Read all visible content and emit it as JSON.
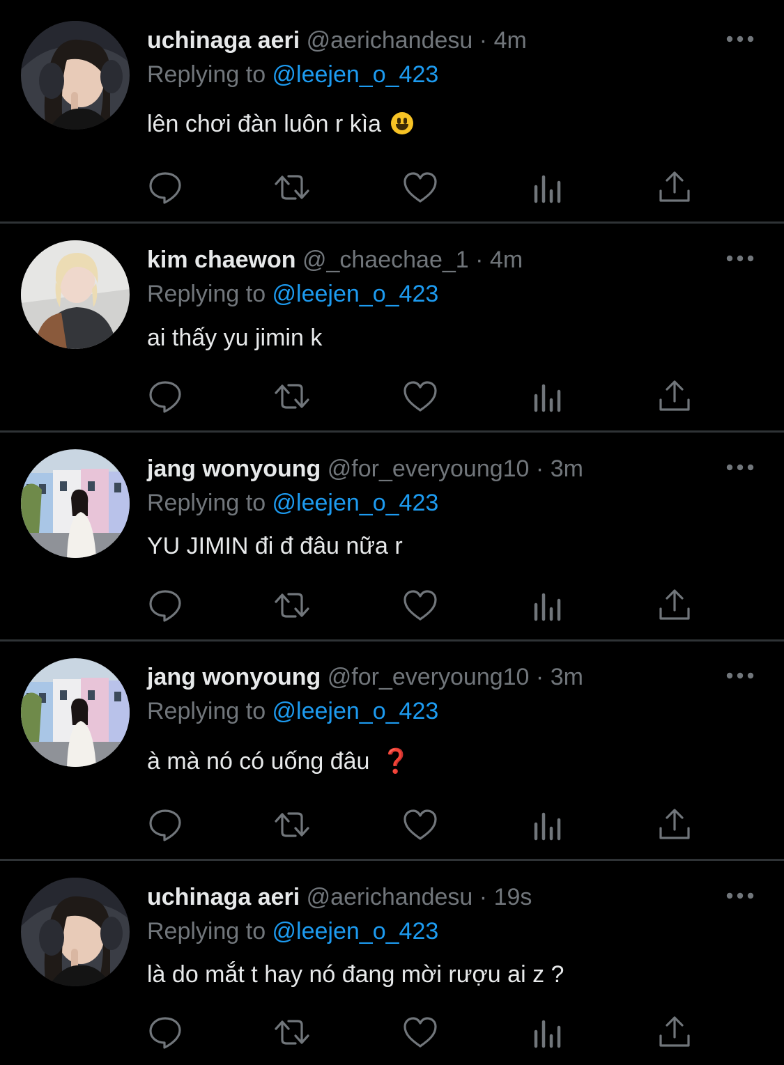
{
  "colors": {
    "background": "#000000",
    "divider": "#2f3336",
    "text_primary": "#e7e9ea",
    "text_secondary": "#71767b",
    "mention": "#1d9bf0"
  },
  "icons": {
    "more": "more-horizontal-icon",
    "reply": "reply-icon",
    "retweet": "retweet-icon",
    "like": "heart-icon",
    "views": "views-icon",
    "share": "share-icon"
  },
  "tweets": [
    {
      "name": "uchinaga aeri",
      "handle": "@aerichandesu",
      "separator": "·",
      "time": "4m",
      "reply_prefix": "Replying to ",
      "reply_to": "@leejen_o_423",
      "text": "lên chơi đàn luôn r kìa",
      "emoji": "grinning-face"
    },
    {
      "name": "kim chaewon",
      "handle": "@_chaechae_1",
      "separator": "·",
      "time": "4m",
      "reply_prefix": "Replying to ",
      "reply_to": "@leejen_o_423",
      "text": "ai thấy yu jimin k"
    },
    {
      "name": "jang wonyoung",
      "handle": "@for_everyoung10",
      "separator": "·",
      "time": "3m",
      "reply_prefix": "Replying to ",
      "reply_to": "@leejen_o_423",
      "text": "YU JIMIN đi đ đâu nữa r"
    },
    {
      "name": "jang wonyoung",
      "handle": "@for_everyoung10",
      "separator": "·",
      "time": "3m",
      "reply_prefix": "Replying to ",
      "reply_to": "@leejen_o_423",
      "text": "à mà nó có uống đâu",
      "emoji_text": "❓"
    },
    {
      "name": "uchinaga aeri",
      "handle": "@aerichandesu",
      "separator": "·",
      "time": "19s",
      "reply_prefix": "Replying to ",
      "reply_to": "@leejen_o_423",
      "text": "là do mắt t hay nó đang mời rượu ai z ?"
    }
  ]
}
